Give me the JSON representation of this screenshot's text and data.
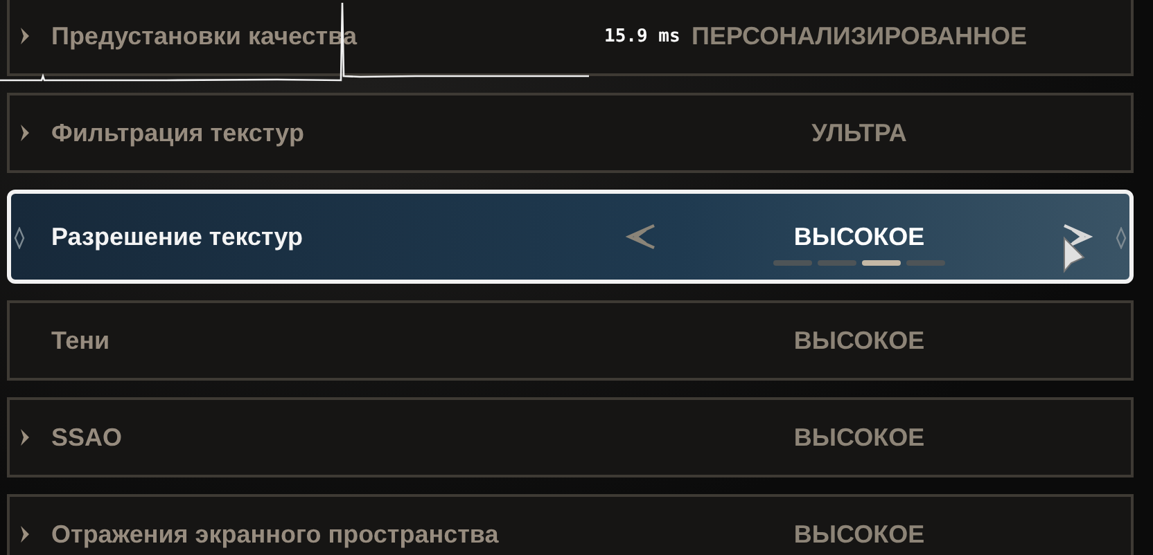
{
  "overlay": {
    "frame_time": "15.9 ms"
  },
  "settings": [
    {
      "label": "Предустановки качества",
      "value": "ПЕРСОНАЛИЗИРОВАННОЕ",
      "expandable": true,
      "selected": false
    },
    {
      "label": "Фильтрация текстур",
      "value": "УЛЬТРА",
      "expandable": true,
      "selected": false
    },
    {
      "label": "Разрешение текстур",
      "value": "ВЫСОКОЕ",
      "expandable": false,
      "selected": true,
      "pager": [
        {
          "selected": false
        },
        {
          "selected": false
        },
        {
          "selected": true
        },
        {
          "selected": false
        }
      ]
    },
    {
      "label": "Тени",
      "value": "ВЫСОКОЕ",
      "expandable": false,
      "selected": false
    },
    {
      "label": "SSAO",
      "value": "ВЫСОКОЕ",
      "expandable": true,
      "selected": false
    },
    {
      "label": "Отражения экранного пространства",
      "value": "ВЫСОКОЕ",
      "expandable": true,
      "selected": false
    }
  ]
}
